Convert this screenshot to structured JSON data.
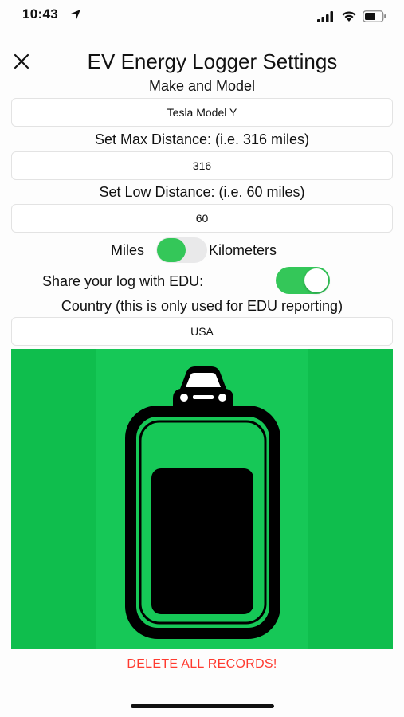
{
  "status_bar": {
    "time": "10:43"
  },
  "header": {
    "title": "EV Energy Logger Settings"
  },
  "fields": {
    "make_model_label": "Make and Model",
    "make_model_value": "Tesla Model Y",
    "max_distance_label": "Set Max Distance: (i.e. 316 miles)",
    "max_distance_value": "316",
    "low_distance_label": "Set Low Distance: (i.e. 60 miles)",
    "low_distance_value": "60",
    "country_label": "Country (this is only used for EDU reporting)",
    "country_value": "USA"
  },
  "units": {
    "left_label": "Miles",
    "right_label": "Kilometers",
    "is_kilometers": false
  },
  "share": {
    "label": "Share your log with EDU:",
    "enabled": true
  },
  "battery_graphic": {
    "level": 0.75
  },
  "actions": {
    "delete_label": "DELETE ALL RECORDS!"
  },
  "colors": {
    "accent_green": "#34c759",
    "graphic_green": "#0fbe4d",
    "destructive_red": "#ff3b30"
  },
  "icons": [
    "location-arrow-icon",
    "cellular-signal-icon",
    "wifi-icon",
    "battery-icon",
    "close-icon",
    "car-icon"
  ]
}
